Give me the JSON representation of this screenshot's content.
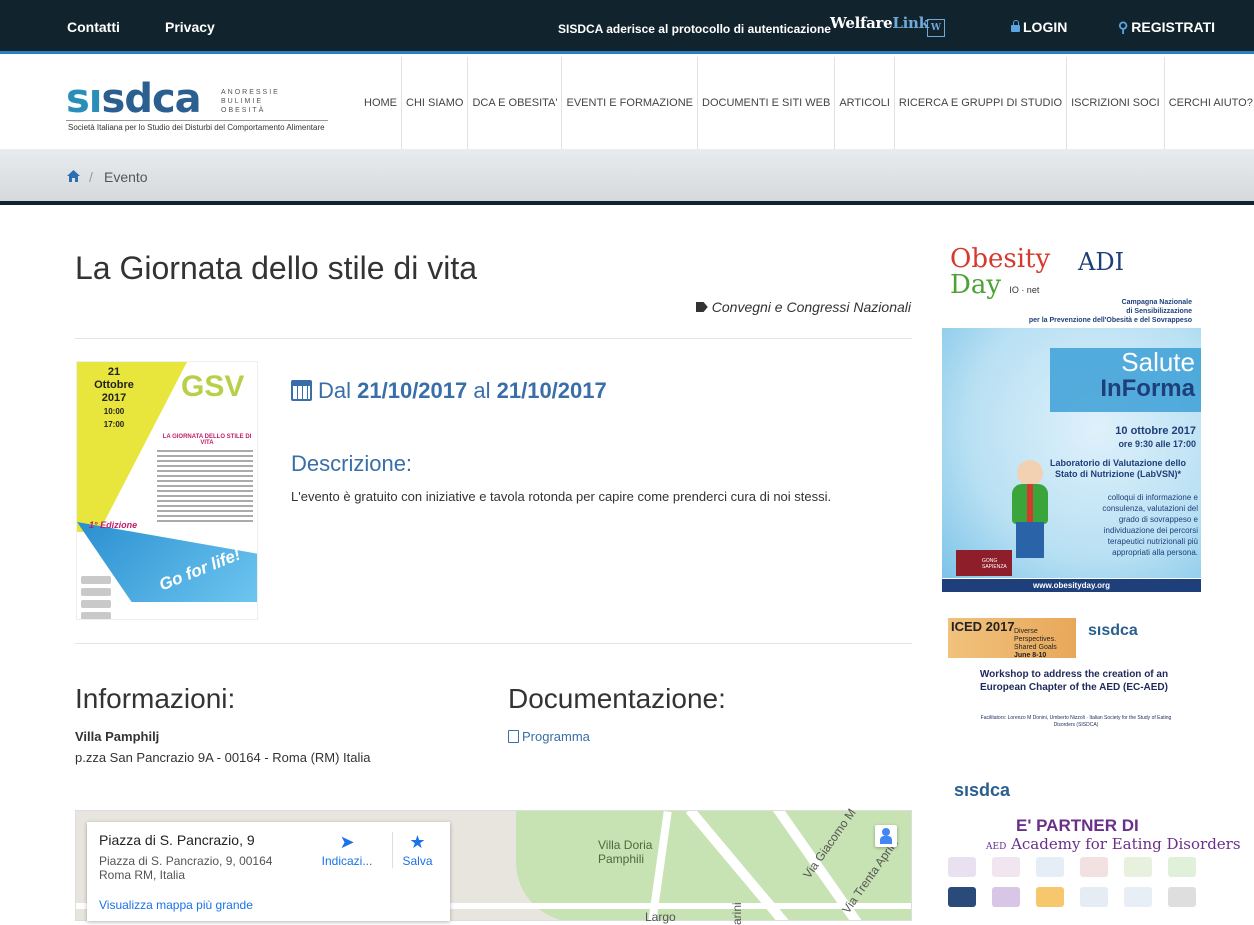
{
  "topbar": {
    "contatti": "Contatti",
    "privacy": "Privacy",
    "auth_text": "SISDCA aderisce al protocollo di autenticazione",
    "welfare_a": "Welfare",
    "welfare_b": "Link",
    "welfare_mark": "W",
    "login": "LOGIN",
    "registrati": "REGISTRATI"
  },
  "logo": {
    "wordmark_a": "sı",
    "wordmark_b": "sdca",
    "side_1": "ANORESSIE",
    "side_2": "BULIMIE",
    "side_3": "OBESITÀ",
    "tagline": "Società Italiana per lo Studio dei Disturbi del Comportamento Alimentare"
  },
  "nav": {
    "items": [
      "HOME",
      "CHI SIAMO",
      "DCA E OBESITA'",
      "EVENTI E FORMAZIONE",
      "DOCUMENTI E SITI WEB",
      "ARTICOLI",
      "RICERCA E GRUPPI DI STUDIO",
      "ISCRIZIONI SOCI",
      "CERCHI AIUTO?"
    ]
  },
  "breadcrumb": {
    "current": "Evento",
    "separator": "/"
  },
  "event": {
    "title": "La Giornata dello stile di vita",
    "category": "Convegni e Congressi Nazionali",
    "date_prefix": "Dal",
    "date_from": "21/10/2017",
    "date_mid": "al",
    "date_to": "21/10/2017",
    "desc_heading": "Descrizione:",
    "description": "L'evento è gratuito con iniziative e tavola rotonda per capire come prenderci cura di noi stessi."
  },
  "poster": {
    "day": "21",
    "month": "Ottobre",
    "year": "2017",
    "time_from": "10:00",
    "time_to": "17:00",
    "gsv": "GSV",
    "title": "LA GIORNATA DELLO STILE DI VITA",
    "edition": "1° Edizione",
    "slogan": "Go for life!"
  },
  "info": {
    "heading": "Informazioni:",
    "venue": "Villa Pamphilj",
    "address": "p.zza San Pancrazio 9A - 00164 - Roma (RM) Italia"
  },
  "docs": {
    "heading": "Documentazione:",
    "link": "Programma"
  },
  "map": {
    "place": "Piazza di S. Pancrazio, 9",
    "address_1": "Piazza di S. Pancrazio, 9, 00164",
    "address_2": "Roma RM, Italia",
    "bigger_link": "Visualizza mappa più grande",
    "directions": "Indicazi...",
    "save": "Salva",
    "label_park_1": "Villa Doria",
    "label_park_2": "Pamphili",
    "label_street_1": "Via Giacomo M",
    "label_street_2": "Via Trenta Aprile",
    "label_street_3": "Largo",
    "label_street_4": "arini"
  },
  "sidebar": {
    "ad1": {
      "obesity": "Obesity",
      "day": "Day",
      "ionet": "IO · net",
      "adi": "ADI",
      "campaign_1": "Campagna Nazionale",
      "campaign_2": "di Sensibilizzazione",
      "campaign_3": "per la Prevenzione dell'Obesità e del Sovrappeso",
      "salute": "Salute",
      "informa": "InForma",
      "date": "10 ottobre 2017",
      "time": "ore 9:30 alle 17:00",
      "lab": "Laboratorio di Valutazione dello Stato di Nutrizione (LabVSN)*",
      "colloqui": "colloqui di informazione e consulenza, valutazioni del grado di sovrappeso e individuazione dei percorsi terapeutici nutrizionali più appropriati alla persona.",
      "gong": "GONG SAPIENZA",
      "url": "www.obesityday.org"
    },
    "ad2": {
      "iced": "ICED 2017",
      "iced_sub_1": "Diverse Perspectives.",
      "iced_sub_2": "Shared Goals",
      "iced_sub_3": "June 8-10",
      "mini_logo": "sısdca",
      "workshop": "Workshop to address the creation of an European Chapter of the AED (EC-AED)",
      "facilitators": "Facilitators: Lorenzo M Donini, Umberto Nizzoli · Italian Society for the Study of Eating Disorders (SISDCA)"
    },
    "ad3": {
      "mini_logo": "sısdca",
      "partner": "E' PARTNER DI",
      "aed": "Academy for Eating Disorders",
      "aed_short": "AED"
    }
  },
  "colors": {
    "topbar_bg": "#11232d",
    "accent_blue": "#3a6ea8",
    "link_blue": "#2c7fbf"
  }
}
